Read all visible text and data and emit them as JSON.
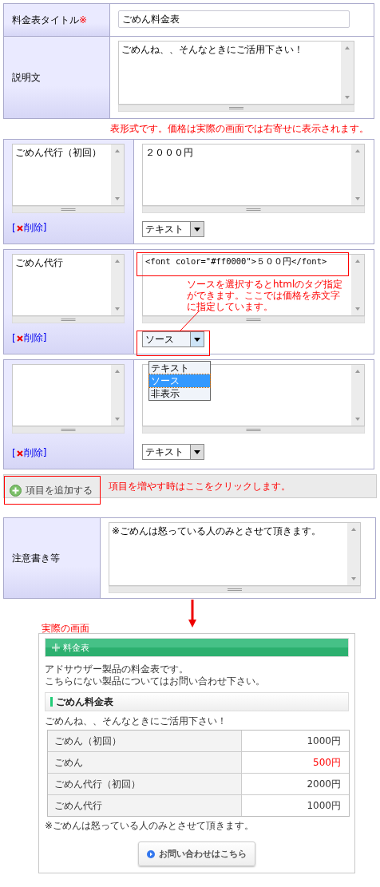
{
  "form": {
    "title_label": "料金表タイトル",
    "required_mark": "※",
    "title_value": "ごめん料金表",
    "description_label": "説明文",
    "description_value": "ごめんね、、そんなときにご活用下さい！"
  },
  "table_note": "表形式です。価格は実際の画面では右寄せに表示されます。",
  "items": [
    {
      "name": "ごめん代行（初回）",
      "price": "２０００円",
      "format": "テキスト",
      "delete": {
        "open": "[",
        "label": "削除",
        "close": "]"
      },
      "dropdown_open": false,
      "highlighted": false
    },
    {
      "name": "ごめん代行",
      "price": "<font color=\"#ff0000\">５００円</font>",
      "format": "ソース",
      "delete": {
        "open": "[",
        "label": "削除",
        "close": "]"
      },
      "dropdown_open": true,
      "highlighted": true,
      "annotation": "ソースを選択するとhtmlのタグ指定ができます。ここでは価格を赤文字に指定しています。",
      "options": [
        {
          "label": "テキスト",
          "selected": false
        },
        {
          "label": "ソース",
          "selected": true
        },
        {
          "label": "非表示",
          "selected": false
        }
      ]
    },
    {
      "format": "テキスト",
      "delete": {
        "open": "[",
        "label": "削除",
        "close": "]"
      },
      "dropdown_open": false,
      "highlighted": false
    }
  ],
  "add_item": {
    "label": "項目を追加する",
    "hint": "項目を増やす時はここをクリックします。"
  },
  "notes": {
    "label": "注意書き等",
    "value": "※ごめんは怒っている人のみとさせて頂きます。"
  },
  "preview": {
    "caption": "実際の画面",
    "header": "料金表",
    "intro": [
      "アドサウザー製品の料金表です。",
      "こちらにない製品についてはお問い合わせ下さい。"
    ],
    "table_title": "ごめん料金表",
    "description": "ごめんね、、そんなときにご活用下さい！",
    "rows": [
      {
        "name": "ごめん（初回）",
        "price": "1000円",
        "color": "#333333"
      },
      {
        "name": "ごめん",
        "price": "500円",
        "color": "#ff0000"
      },
      {
        "name": "ごめん代行（初回）",
        "price": "2000円",
        "color": "#333333"
      },
      {
        "name": "ごめん代行",
        "price": "1000円",
        "color": "#333333"
      }
    ],
    "note": "※ごめんは怒っている人のみとさせて頂きます。",
    "button": "お問い合わせはこちら"
  }
}
